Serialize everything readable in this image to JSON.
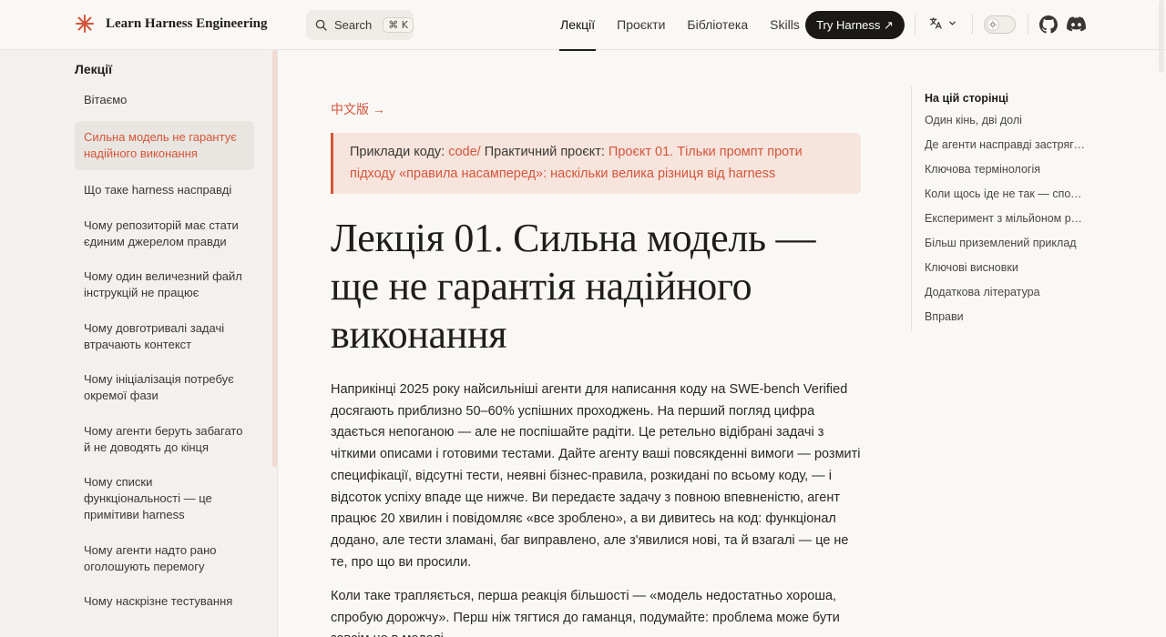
{
  "brand": {
    "name": "Learn Harness Engineering"
  },
  "search": {
    "label": "Search",
    "shortcut": "⌘ K"
  },
  "nav": [
    {
      "label": "Лекції",
      "active": true
    },
    {
      "label": "Проєкти",
      "active": false
    },
    {
      "label": "Бібліотека",
      "active": false
    },
    {
      "label": "Skills",
      "active": false
    }
  ],
  "try_button": "Try Harness ↗",
  "sidebar": {
    "title": "Лекції",
    "items": [
      {
        "label": "Вітаємо",
        "active": false
      },
      {
        "label": "Сильна модель не гарантує надійного виконання",
        "active": true
      },
      {
        "label": "Що таке harness насправді",
        "active": false
      },
      {
        "label": "Чому репозиторій має стати єдиним джерелом правди",
        "active": false
      },
      {
        "label": "Чому один величезний файл інструкцій не працює",
        "active": false
      },
      {
        "label": "Чому довготривалі задачі втрачають контекст",
        "active": false
      },
      {
        "label": "Чому ініціалізація потребує окремої фази",
        "active": false
      },
      {
        "label": "Чому агенти беруть забагато й не доводять до кінця",
        "active": false
      },
      {
        "label": "Чому списки функціональності — це примітиви harness",
        "active": false
      },
      {
        "label": "Чому агенти надто рано оголошують перемогу",
        "active": false
      },
      {
        "label": "Чому наскрізне тестування",
        "active": false
      }
    ]
  },
  "main": {
    "lang_link": "中文版 →",
    "callout": {
      "prefix": "Приклади коду: ",
      "code_link": "code/",
      "middle": " Практичний проєкт: ",
      "project_link": "Проєкт 01. Тільки промпт проти підходу «правила насамперед»: наскільки велика різниця від harness"
    },
    "title": "Лекція 01. Сильна модель — ще не гарантія надійного виконання",
    "paragraphs": [
      "Наприкінці 2025 року найсильніші агенти для написання коду на SWE-bench Verified досягають приблизно 50–60% успішних проходжень. На перший погляд цифра здається непоганою — але не поспішайте радіти. Це ретельно відібрані задачі з чіткими описами і готовими тестами. Дайте агенту ваші повсякденні вимоги — розмиті специфікації, відсутні тести, неявні бізнес-правила, розкидані по всьому коду, — і відсоток успіху впаде ще нижче. Ви передаєте задачу з повною впевненістю, агент працює 20 хвилин і повідомляє «все зроблено», а ви дивитесь на код: функціонал додано, але тести зламані, баг виправлено, але з'явилися нові, та й взагалі — це не те, про що ви просили.",
      "Коли таке трапляється, перша реакція більшості — «модель недостатньо хороша, спробую дорожчу». Перш ніж тягтися до гаманця, подумайте: проблема може бути зовсім не в моделі."
    ]
  },
  "toc": {
    "title": "На цій сторінці",
    "items": [
      "Один кінь, дві долі",
      "Де агенти насправді застрягають",
      "Ключова термінологія",
      "Коли щось іде не так — спочатку дивіться на harness",
      "Експеримент з мільйоном рядків",
      "Більш приземлений приклад",
      "Ключові висновки",
      "Додаткова література",
      "Вправи"
    ]
  },
  "colors": {
    "accent": "#d4553a",
    "callout_bg": "#f7e4dd",
    "background": "#faf8f5",
    "sidebar_bg": "#f3f1ee"
  }
}
